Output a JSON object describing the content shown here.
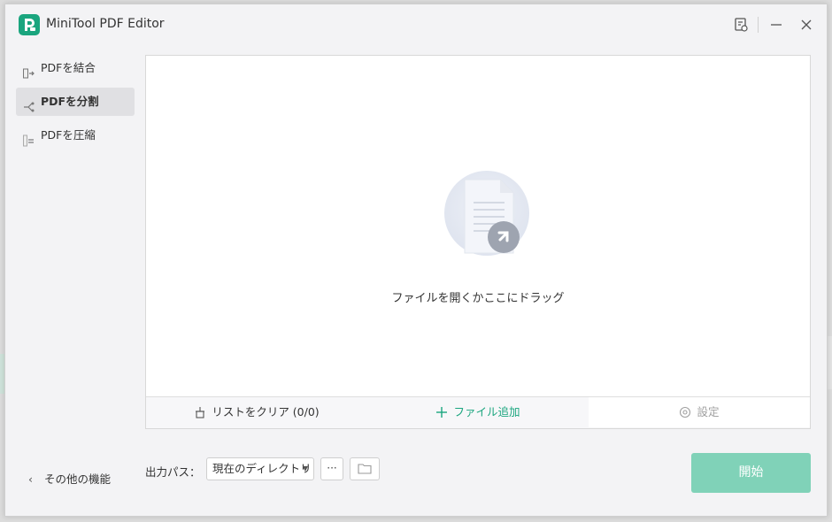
{
  "app": {
    "title": "MiniTool PDF Editor"
  },
  "sidebar": {
    "items": [
      {
        "label": "PDFを結合"
      },
      {
        "label": "PDFを分割"
      },
      {
        "label": "PDFを圧縮"
      }
    ],
    "more": "その他の機能"
  },
  "drop_area": {
    "text": "ファイルを開くかここにドラッグ"
  },
  "panel_toolbar": {
    "clear": "リストをクリア (0/0)",
    "add": "ファイル追加",
    "settings": "設定"
  },
  "output": {
    "label": "出力パス：",
    "selected": "現在のディレクトリ",
    "more_button": "···"
  },
  "start_button": "開始",
  "colors": {
    "accent": "#1aa57e",
    "start_disabled": "#80d2b8"
  }
}
